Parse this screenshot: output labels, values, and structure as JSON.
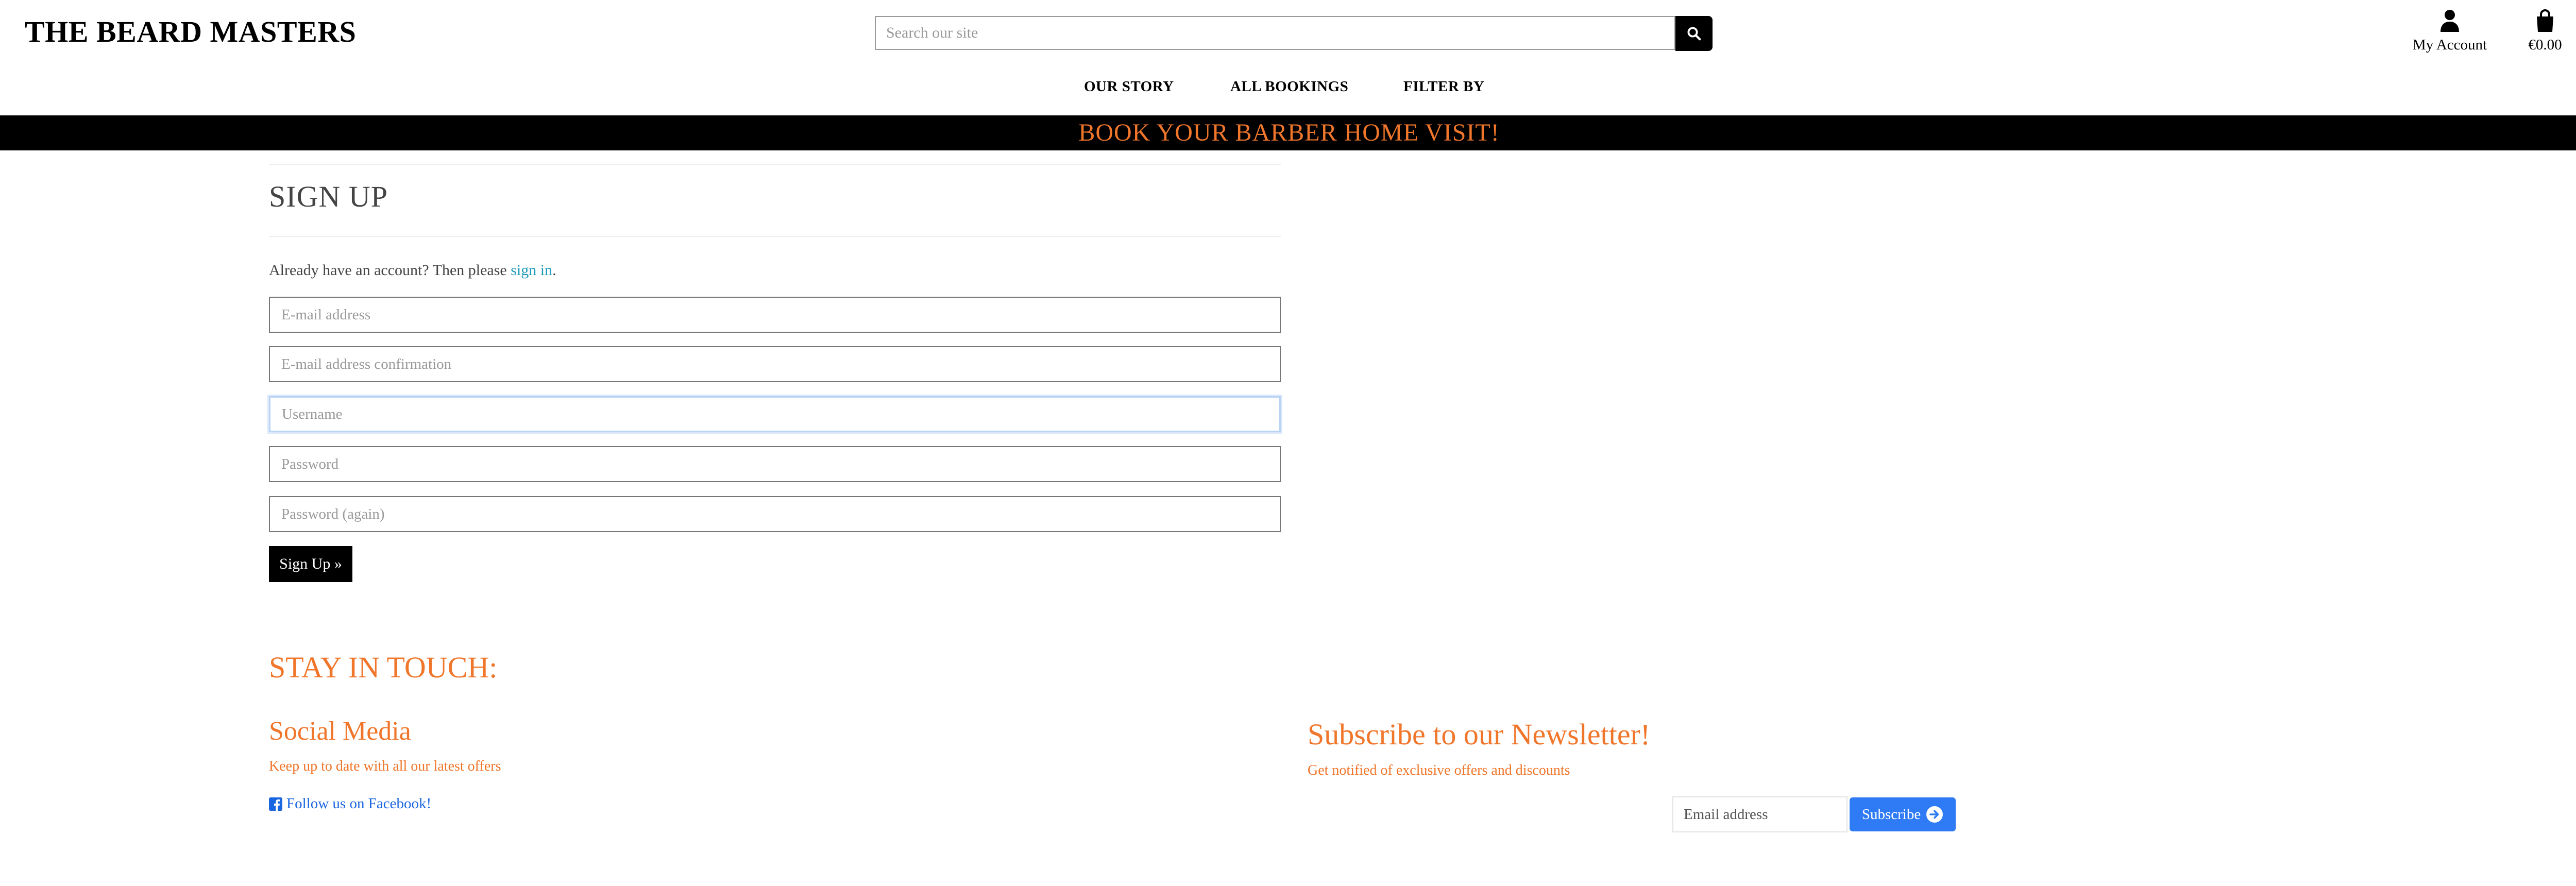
{
  "header": {
    "logo": "THE BEARD MASTERS",
    "search_placeholder": "Search our site",
    "account_label": "My Account",
    "cart_total": "€0.00"
  },
  "nav": {
    "items": [
      {
        "label": "OUR STORY"
      },
      {
        "label": "ALL BOOKINGS"
      },
      {
        "label": "FILTER BY"
      }
    ]
  },
  "banner": {
    "text": "BOOK YOUR BARBER HOME VISIT!"
  },
  "signup": {
    "title": "SIGN UP",
    "note_prefix": "Already have an account? Then please ",
    "note_link": "sign in",
    "note_suffix": ".",
    "fields": {
      "email": "E-mail address",
      "email_confirm": "E-mail address confirmation",
      "username": "Username",
      "password": "Password",
      "password_again": "Password (again)"
    },
    "submit_label": "Sign Up »"
  },
  "footer": {
    "stay_title": "STAY IN TOUCH:",
    "social": {
      "title": "Social Media",
      "subtitle": "Keep up to date with all our latest offers",
      "facebook_label": "Follow us on Facebook!"
    },
    "newsletter": {
      "title": "Subscribe to our Newsletter!",
      "subtitle": "Get notified of exclusive offers and discounts",
      "email_placeholder": "Email address",
      "button_label": "Subscribe"
    }
  },
  "colors": {
    "accent": "#f0762b",
    "link": "#1d9bb8",
    "facebook": "#1a66e0",
    "subscribe": "#2f7bf5",
    "banner_bg": "#000000"
  },
  "icons": {
    "search": "search-icon",
    "account": "user-icon",
    "cart": "shopping-bag-icon",
    "facebook": "facebook-icon",
    "subscribe": "arrow-circle-right-icon"
  }
}
